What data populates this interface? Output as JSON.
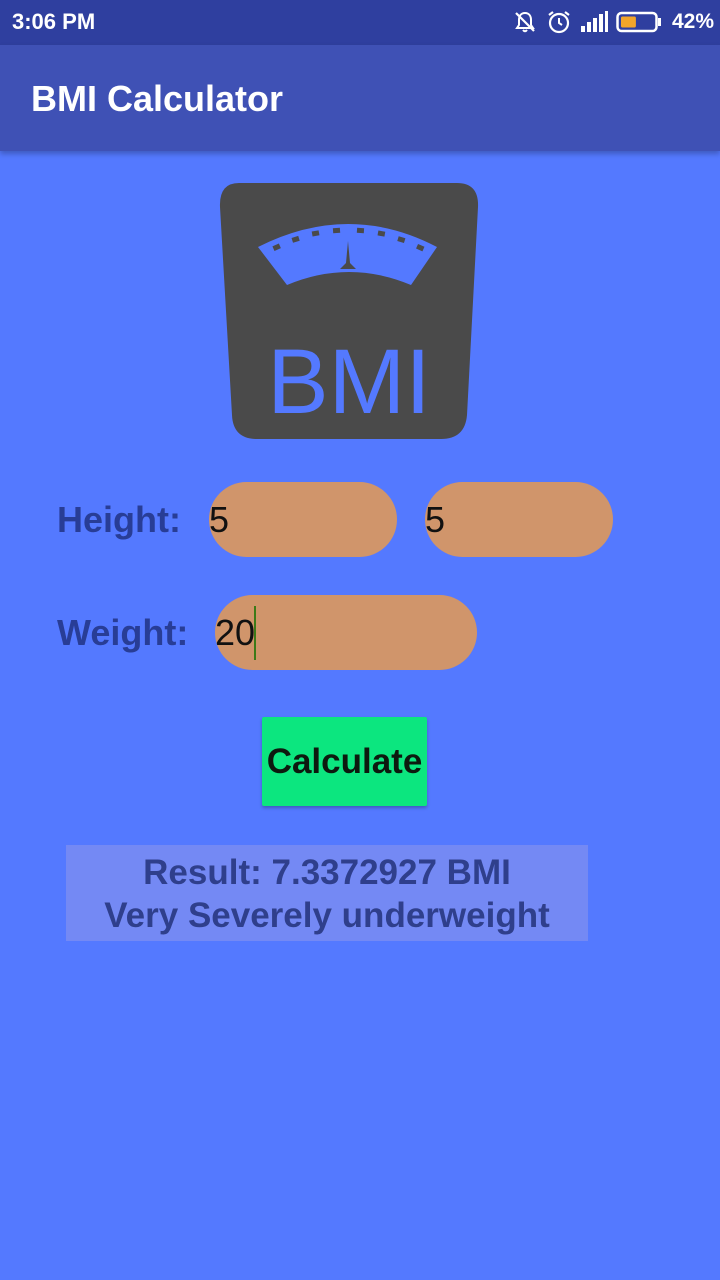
{
  "status_bar": {
    "time": "3:06 PM",
    "battery_percent": "42%",
    "battery_level": 0.42,
    "icons": [
      "notifications-off-icon",
      "alarm-icon",
      "signal-icon",
      "battery-icon"
    ]
  },
  "app_bar": {
    "title": "BMI Calculator"
  },
  "logo": {
    "text": "BMI",
    "icon": "bmi-scale-logo"
  },
  "form": {
    "height_label": "Height:",
    "height_feet": "5",
    "height_inches": "5",
    "weight_label": "Weight:",
    "weight_value": "20",
    "calculate_label": "Calculate"
  },
  "result": {
    "line1": "Result: 7.3372927 BMI",
    "line2": "Very Severely underweight"
  },
  "colors": {
    "status_bar": "#2f3f9f",
    "app_bar": "#3f51b5",
    "background": "#5479ff",
    "input_fill": "#d0956b",
    "button_fill": "#0ce67f",
    "result_fill": "#7489f4",
    "label_text": "#283d96"
  }
}
